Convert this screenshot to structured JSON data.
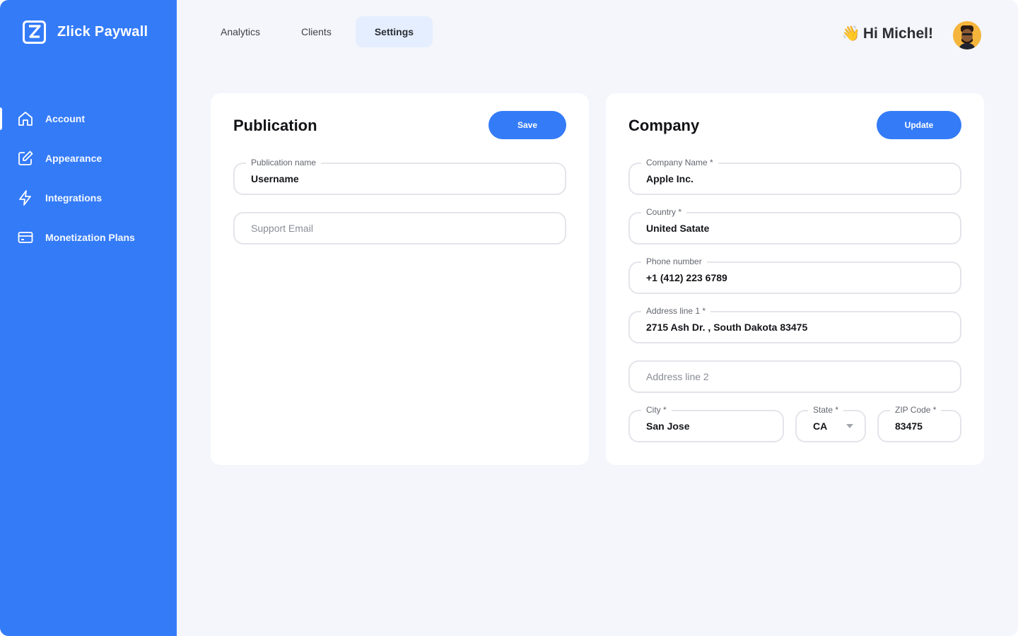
{
  "brand": {
    "name": "Zlick Paywall"
  },
  "sidebar": {
    "items": [
      {
        "label": "Account",
        "icon": "home-icon",
        "active": true
      },
      {
        "label": "Appearance",
        "icon": "edit-icon",
        "active": false
      },
      {
        "label": "Integrations",
        "icon": "lightning-icon",
        "active": false
      },
      {
        "label": "Monetization Plans",
        "icon": "credit-card-icon",
        "active": false
      }
    ]
  },
  "header": {
    "tabs": [
      {
        "label": "Analytics",
        "active": false
      },
      {
        "label": "Clients",
        "active": false
      },
      {
        "label": "Settings",
        "active": true
      }
    ],
    "greeting": "Hi Michel!",
    "greeting_icon": "waving-hand-icon"
  },
  "publication": {
    "title": "Publication",
    "button": "Save",
    "fields": {
      "name": {
        "label": "Publication name",
        "value": "Username"
      },
      "support_email": {
        "placeholder": "Support Email"
      }
    }
  },
  "company": {
    "title": "Company",
    "button": "Update",
    "fields": {
      "name": {
        "label": "Company Name *",
        "value": "Apple Inc."
      },
      "country": {
        "label": "Country *",
        "value": "United Satate"
      },
      "phone": {
        "label": "Phone number",
        "value": "+1 (412) 223 6789"
      },
      "address1": {
        "label": "Address line 1 *",
        "value": "2715 Ash Dr. , South Dakota 83475"
      },
      "address2": {
        "placeholder": "Address line 2"
      },
      "city": {
        "label": "City *",
        "value": "San Jose"
      },
      "state": {
        "label": "State *",
        "value": "CA"
      },
      "zip": {
        "label": "ZIP Code *",
        "value": "83475"
      }
    }
  },
  "colors": {
    "accent": "#347bf8",
    "background": "#f4f6fb",
    "tab_active_bg": "#e5eefe"
  }
}
